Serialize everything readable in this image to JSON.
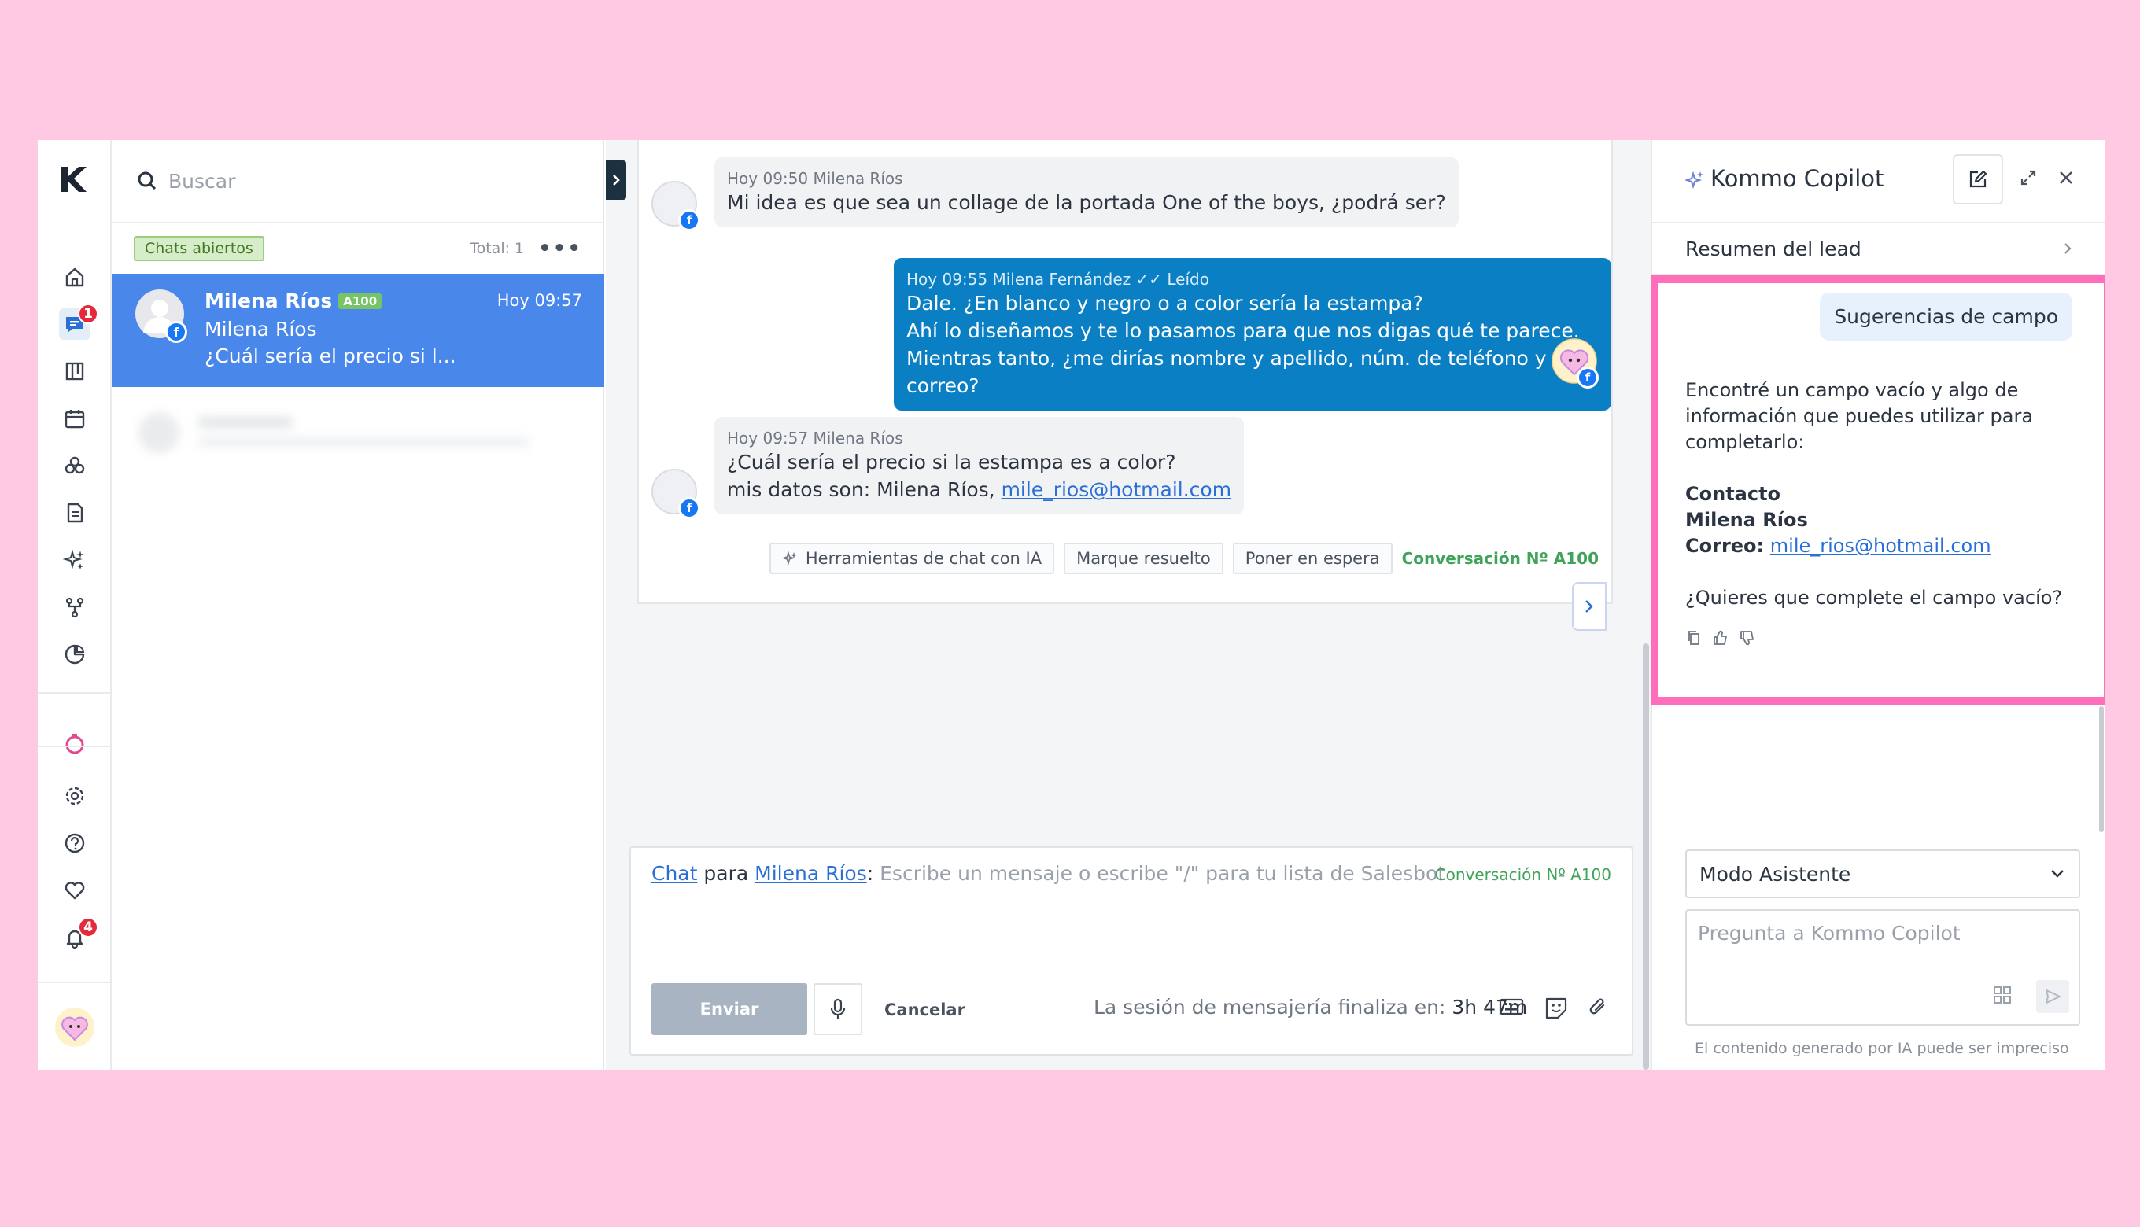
{
  "search": {
    "placeholder": "Buscar"
  },
  "rail": {
    "chat_badge": "1",
    "notif_badge": "4"
  },
  "list": {
    "filter_chip": "Chats abiertos",
    "total": "Total: 1",
    "selected_chat": {
      "name": "Milena Ríos",
      "tag": "A100",
      "time": "Hoy 09:57",
      "subtitle": "Milena Ríos",
      "preview": "¿Cuál sería el precio si l..."
    }
  },
  "messages": [
    {
      "meta": "Hoy 09:50 Milena Ríos",
      "text": "Mi idea es que sea un collage de la portada One of the boys, ¿podrá ser?"
    },
    {
      "meta": "Hoy 09:55 Milena Fernández",
      "status": "Leído",
      "lines": [
        "Dale. ¿En blanco y negro o a color sería la estampa?",
        "Ahí lo diseñamos y te lo pasamos para que nos digas qué te parece.",
        "Mientras tanto, ¿me dirías nombre y apellido, núm. de teléfono y correo?"
      ]
    },
    {
      "meta": "Hoy 09:57 Milena Ríos",
      "line1": "¿Cuál sería el precio si la estampa es a color?",
      "line2_prefix": "mis datos son: Milena Ríos,",
      "email": "mile_rios@hotmail.com"
    }
  ],
  "actions": {
    "ai_tools": "Herramientas de chat con IA",
    "resolve": "Marque resuelto",
    "hold": "Poner en espera",
    "conversation": "Conversación Nº A100"
  },
  "composer": {
    "channel": "Chat",
    "para": "para",
    "recipient": "Milena Ríos",
    "colon": ":",
    "placeholder": "Escribe un mensaje o escribe \"/\" para tu lista de Salesbot",
    "conversation": "Conversación Nº A100",
    "send": "Enviar",
    "cancel": "Cancelar",
    "session_label": "La sesión de mensajería finaliza en:",
    "session_time": "3h 47m"
  },
  "copilot": {
    "title": "Kommo Copilot",
    "summary": "Resumen del lead",
    "suggestion": "Sugerencias de campo",
    "intro": "Encontré un campo vacío y algo de información que puedes utilizar para completarlo:",
    "section": "Contacto",
    "contact_name": "Milena Ríos",
    "email_label": "Correo:",
    "email": "mile_rios@hotmail.com",
    "question": "¿Quieres que complete el campo vacío?",
    "mode": "Modo Asistente",
    "ask_placeholder": "Pregunta a Kommo Copilot",
    "disclaimer": "El contenido generado por IA puede ser impreciso"
  }
}
